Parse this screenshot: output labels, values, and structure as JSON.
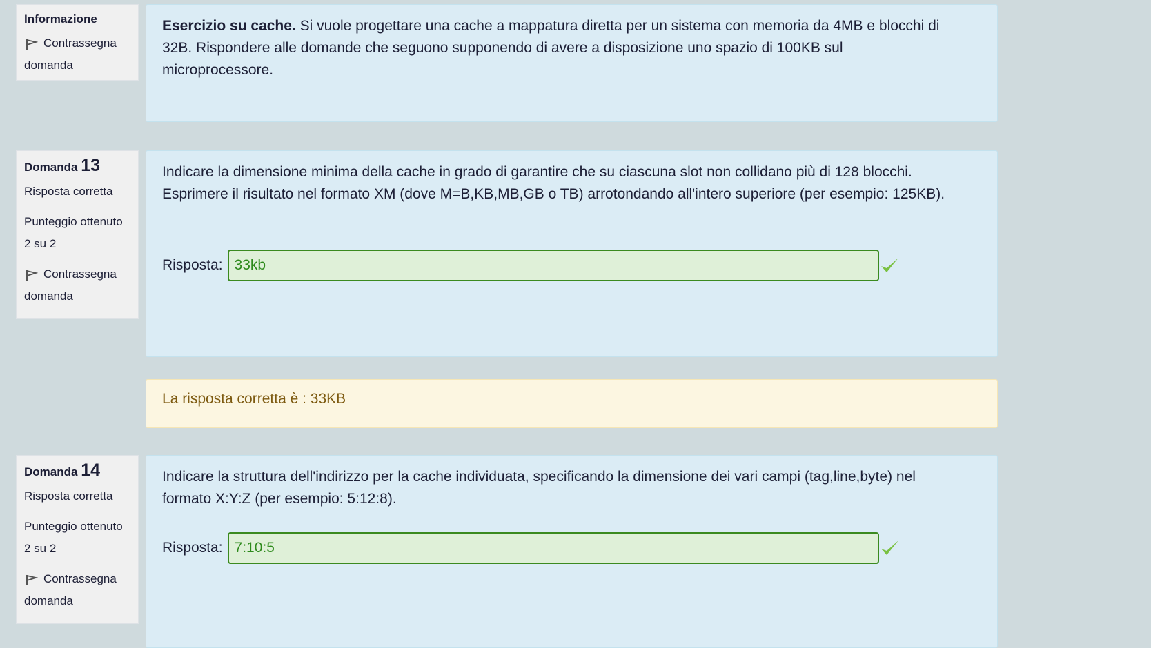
{
  "info": {
    "title": "Informazione",
    "flag_label": "Contrassegna domanda",
    "text_bold": "Esercizio su cache.",
    "text": " Si vuole progettare una cache a mappatura diretta per un sistema con memoria da 4MB e blocchi di 32B. Rispondere alle domande che seguono supponendo di avere a disposizione uno spazio di 100KB sul microprocessore."
  },
  "questions": [
    {
      "label": "Domanda",
      "number": "13",
      "status": "Risposta corretta",
      "score_label": "Punteggio ottenuto",
      "score_value": "2 su 2",
      "flag_label": "Contrassegna domanda",
      "text": "Indicare la dimensione minima della cache in grado di garantire che su ciascuna slot non collidano più di 128 blocchi. Esprimere il risultato nel formato XM (dove M=B,KB,MB,GB o TB) arrotondando all'intero superiore (per esempio: 125KB).",
      "answer_label": "Risposta:",
      "answer_value": "33kb",
      "feedback": "La risposta corretta è : 33KB"
    },
    {
      "label": "Domanda",
      "number": "14",
      "status": "Risposta corretta",
      "score_label": "Punteggio ottenuto",
      "score_value": "2 su 2",
      "flag_label": "Contrassegna domanda",
      "text": "Indicare la struttura dell'indirizzo per la cache individuata, specificando la dimensione dei vari campi (tag,line,byte) nel formato X:Y:Z (per esempio: 5:12:8).",
      "answer_label": "Risposta:",
      "answer_value": "7:10:5"
    }
  ],
  "icons": {
    "flag": "flag-icon",
    "check": "check-icon"
  },
  "colors": {
    "background": "#cfdadd",
    "content_bg": "#dbecf5",
    "info_bg": "#f0f0f0",
    "correct_border": "#3b8a1f",
    "correct_bg": "#dff0d8",
    "check": "#7ac142",
    "feedback_bg": "#fcf6e1",
    "feedback_text": "#7d5a10"
  }
}
